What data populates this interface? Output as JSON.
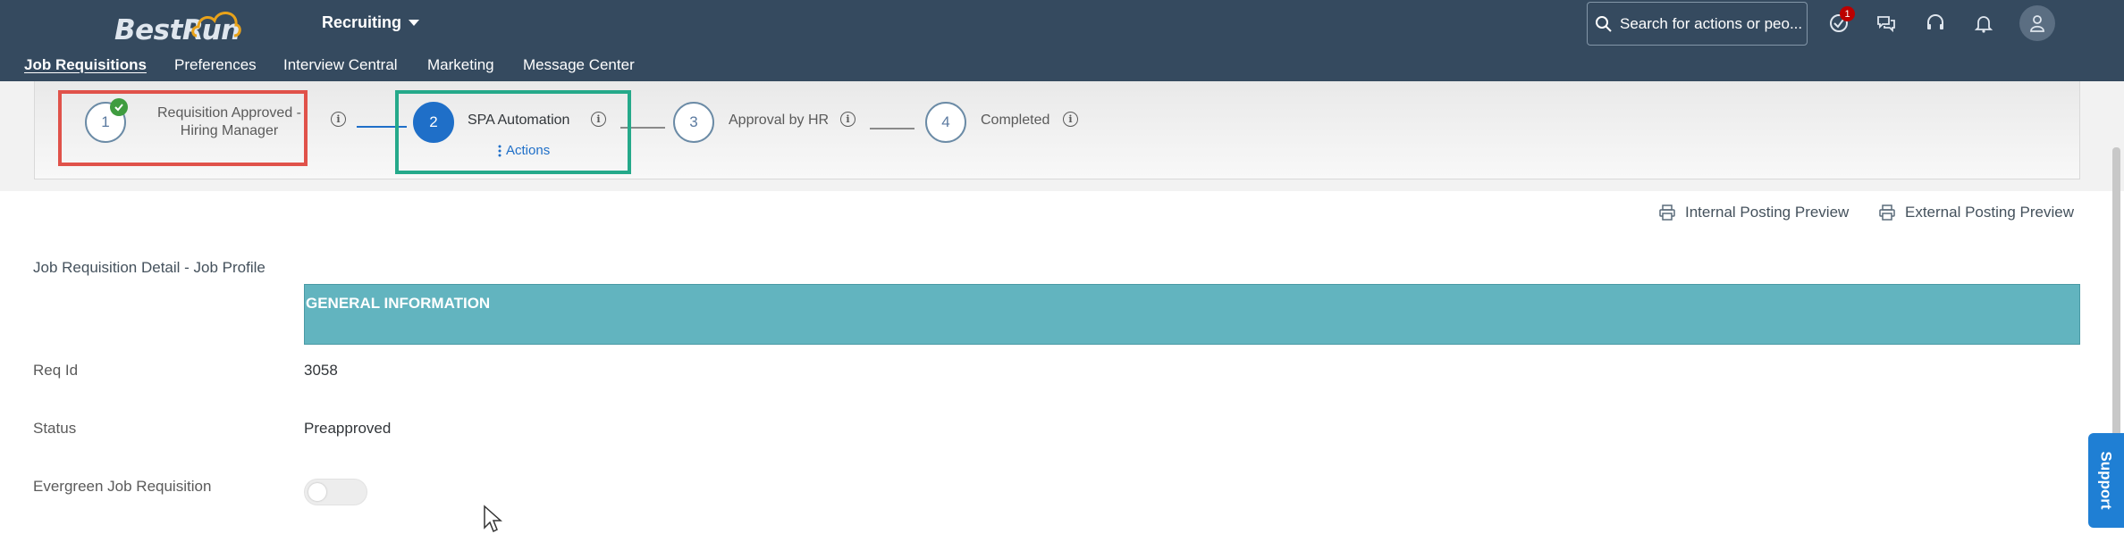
{
  "header": {
    "logo_text": "BestRun",
    "module": "Recruiting",
    "search_placeholder": "Search for actions or peo...",
    "notification_count": "1",
    "icons": [
      "todo-check-icon",
      "feedback-icon",
      "support-headset-icon",
      "bell-icon",
      "user-avatar-icon"
    ]
  },
  "nav": {
    "items": [
      "Job Requisitions",
      "Preferences",
      "Interview Central",
      "Marketing",
      "Message Center"
    ],
    "active": "Job Requisitions"
  },
  "progress": {
    "steps": [
      {
        "number": "1",
        "label_line1": "Requisition Approved -",
        "label_line2": "Hiring Manager",
        "status": "completed"
      },
      {
        "number": "2",
        "label": "SPA Automation",
        "status": "current"
      },
      {
        "number": "3",
        "label": "Approval by HR",
        "status": "pending"
      },
      {
        "number": "4",
        "label": "Completed",
        "status": "pending"
      }
    ],
    "actions_label": "Actions"
  },
  "previews": {
    "internal": "Internal Posting Preview",
    "external": "External Posting Preview"
  },
  "detail": {
    "title": "Job Requisition Detail - Job Profile",
    "section_header": "GENERAL INFORMATION",
    "fields": [
      {
        "label": "Req Id",
        "value": "3058"
      },
      {
        "label": "Status",
        "value": "Preapproved"
      },
      {
        "label": "Evergreen Job Requisition",
        "value": "off"
      }
    ]
  },
  "support_label": "Support",
  "colors": {
    "header_bg": "#354a5f",
    "section_bg": "#62b4bf",
    "current_step": "#1f6fc8",
    "highlight_red": "#e0524a",
    "highlight_green": "#25a98a",
    "support_tab": "#1f7fd4"
  }
}
